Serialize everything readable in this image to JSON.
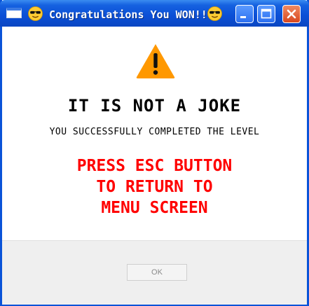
{
  "window": {
    "title": "Congratulations You WON!!",
    "title_prefix_icon": "sunglasses-emoji",
    "title_suffix_icon": "sunglasses-emoji",
    "buttons": {
      "minimize": "minimize-icon",
      "maximize": "maximize-icon",
      "close": "close-icon"
    }
  },
  "dialog": {
    "icon": "warning-icon",
    "heading": "IT IS NOT A JOKE",
    "subheading": "YOU SUCCESSFULLY COMPLETED THE LEVEL",
    "message_lines": [
      "PRESS ESC BUTTON",
      "TO RETURN TO",
      "MENU SCREEN"
    ],
    "ok_label": "OK"
  },
  "colors": {
    "titlebar": "#0b4fd6",
    "message": "#ff0000",
    "warning": "#ff9800",
    "footer": "#efefef"
  }
}
